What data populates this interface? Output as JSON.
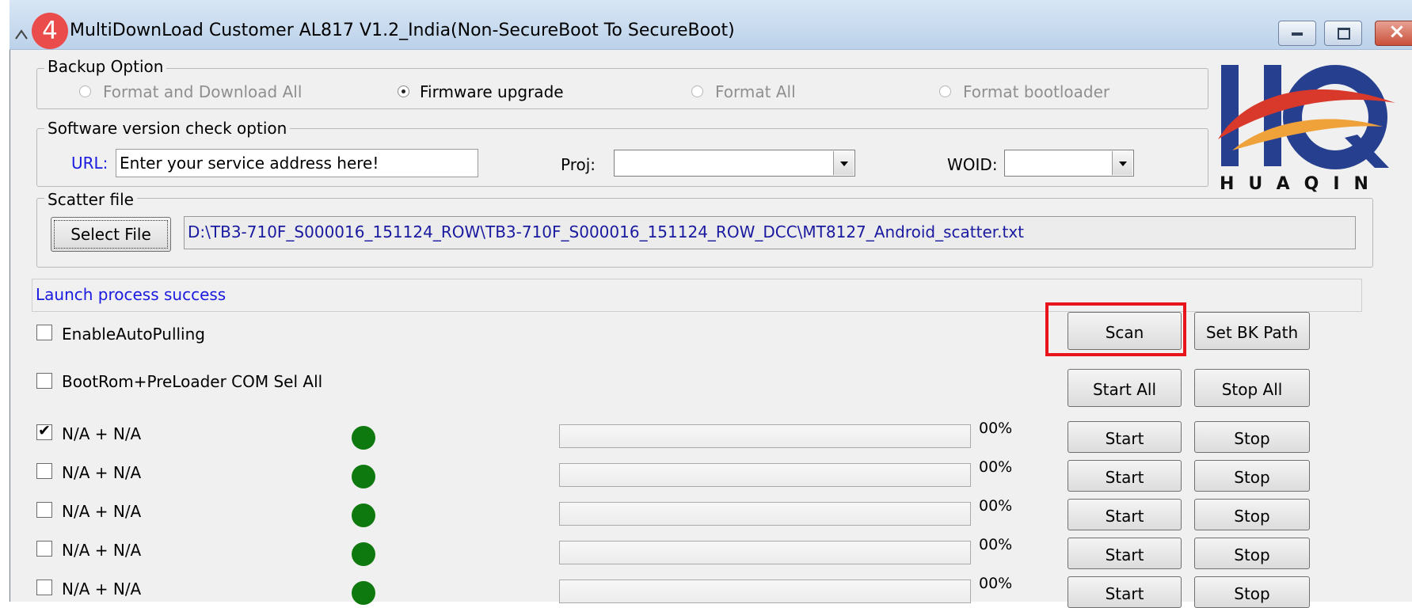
{
  "step_badge": "4",
  "window": {
    "title": "MultiDownLoad Customer AL817 V1.2_India(Non-SecureBoot To SecureBoot)",
    "controls": [
      "minimize-icon",
      "maximize-icon",
      "close-icon"
    ]
  },
  "backup": {
    "label": "Backup Option",
    "options": [
      {
        "label": "Format and Download All",
        "checked": false,
        "enabled": false
      },
      {
        "label": "Firmware upgrade",
        "checked": true,
        "enabled": true
      },
      {
        "label": "Format All",
        "checked": false,
        "enabled": false
      },
      {
        "label": "Format bootloader",
        "checked": false,
        "enabled": false
      }
    ]
  },
  "version": {
    "label": "Software version check option",
    "url_label": "URL:",
    "url_placeholder": "Enter your service address here!",
    "url_value": "",
    "proj_label": "Proj:",
    "proj_value": "",
    "woid_label": "WOID:",
    "woid_value": ""
  },
  "logo": {
    "text": "HUAQIN",
    "colors": {
      "blue": "#273f8f",
      "red": "#d8392b",
      "orange": "#f0a23a"
    }
  },
  "scatter": {
    "label": "Scatter file",
    "button": "Select File",
    "path": "D:\\TB3-710F_S000016_151124_ROW\\TB3-710F_S000016_151124_ROW_DCC\\MT8127_Android_scatter.txt"
  },
  "status_message": "Launch process success",
  "options": {
    "auto_pulling": {
      "label": "EnableAutoPulling",
      "checked": false
    },
    "com_sel_all": {
      "label": "BootRom+PreLoader COM Sel All",
      "checked": false
    }
  },
  "buttons": {
    "scan": "Scan",
    "set_bk_path": "Set BK Path",
    "start_all": "Start All",
    "stop_all": "Stop All"
  },
  "highlight_color": "#e8131b",
  "ports": [
    {
      "label": "N/A + N/A",
      "checked": true,
      "percent": "00%",
      "progress": 0,
      "start": "Start",
      "stop": "Stop"
    },
    {
      "label": "N/A + N/A",
      "checked": false,
      "percent": "00%",
      "progress": 0,
      "start": "Start",
      "stop": "Stop"
    },
    {
      "label": "N/A + N/A",
      "checked": false,
      "percent": "00%",
      "progress": 0,
      "start": "Start",
      "stop": "Stop"
    },
    {
      "label": "N/A + N/A",
      "checked": false,
      "percent": "00%",
      "progress": 0,
      "start": "Start",
      "stop": "Stop"
    },
    {
      "label": "N/A + N/A",
      "checked": false,
      "percent": "00%",
      "progress": 0,
      "start": "Start",
      "stop": "Stop"
    }
  ]
}
